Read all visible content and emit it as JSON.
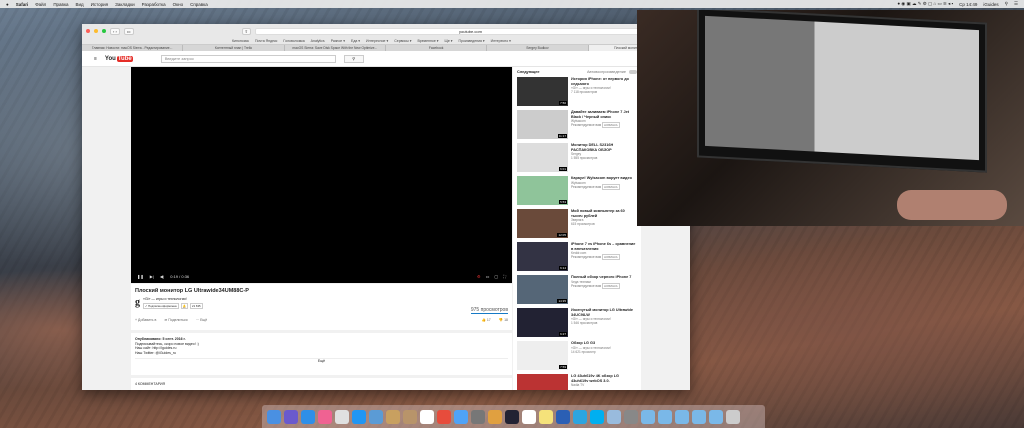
{
  "menubar": {
    "app": "Safari",
    "items": [
      "Файл",
      "Правка",
      "Вид",
      "История",
      "Закладки",
      "Разработка",
      "Окно",
      "Справка"
    ],
    "clock": "Ср 14:49",
    "user": "iGuides"
  },
  "safari": {
    "url": "youtube.com",
    "bookmarks": [
      "Кинопоиск",
      "Почта Яндекс",
      "Головоломка",
      "Analytics",
      "Разное ▾",
      "Еда ▾",
      "Интересное ▾",
      "Сервисы ▾",
      "Временное ▾",
      "Ще ▾",
      "Произведения ▾",
      "Интересно ▾"
    ],
    "tabs": [
      "Главная: Новости: macOS Sierra - Редактирование...",
      "Контентный план | Trello",
      "macOS Sierra: Save Disk Space With the New Optimize...",
      "Facebook",
      "Sergey Budkov",
      "Плоский монитор LG Ultrawide..."
    ]
  },
  "youtube": {
    "logo": "You",
    "logo_tube": "Tube",
    "search_placeholder": "Введите запрос",
    "player": {
      "time": "0:19 / 0:36"
    },
    "video": {
      "title": "Плоский монитор LG Ultrawide34UM88C-P",
      "channel": "«Gi» — игры и технологии!",
      "subscribe": "✓ Подписка оформлена",
      "subs": "21 635",
      "views": "975 просмотров",
      "add": "Добавить в",
      "share": "Поделиться",
      "more": "Ещё",
      "likes": "17",
      "dislikes": "18"
    },
    "description": {
      "published": "Опубликовано: 5 сент. 2016 г.",
      "lines": [
        "Подписывайтесь, скоро новое видео! :)",
        "Наш сайт: http://iguides.ru",
        "Наш Twitter: @iGuides_ru"
      ],
      "more": "Ещё"
    },
    "comments": "4 КОММЕНТАРИЯ",
    "sidebar": {
      "heading": "Следующее",
      "autoplay": "Автовоспроизведение",
      "items": [
        {
          "title": "История iPhone: от первого до седьмого",
          "channel": "«Gi» — игры и технологии!",
          "meta": "7 118 просмотров",
          "duration": "7:50",
          "color": "#333"
        },
        {
          "title": "Давайте заливаем iPhone 7 Jet Black / Черный оникс",
          "channel": "Wylsacom",
          "meta": "Рекомендуемое вам",
          "badge": "НОВИНКА",
          "duration": "11:17",
          "color": "#ccc"
        },
        {
          "title": "Монитор DELL S2316H РАСПАКОВКА ОБЗОР",
          "channel": "Sergey",
          "meta": "1 555 просмотров",
          "duration": "6:01",
          "color": "#ddd"
        },
        {
          "title": "Караул! Wylsacom ворует видео",
          "channel": "Wylsacom",
          "meta": "Рекомендуемое вам",
          "badge": "НОВИНКА",
          "duration": "5:53",
          "color": "#8fc49a"
        },
        {
          "title": "Мой новый компьютер за 60 тысяч рублей",
          "channel": "Зверюга",
          "meta": "615 просмотров",
          "duration": "12:05",
          "color": "#6a4a3a"
        },
        {
          "title": "iPhone 7 vs iPhone 6s – сравнение в впечатления",
          "channel": "Keddr.com",
          "meta": "Рекомендуемое вам",
          "badge": "НОВИНКА",
          "duration": "6:14",
          "color": "#334"
        },
        {
          "title": "Полный обзор черного iPhone 7",
          "channel": "Чеда техники",
          "meta": "Рекомендуемое вам",
          "badge": "НОВИНКА",
          "duration": "14:35",
          "color": "#567"
        },
        {
          "title": "Изогнутый монитор LG Ultrawide 34UC98-W",
          "channel": "«Gi» — игры и технологии!",
          "meta": "1 546 просмотров",
          "duration": "6:27",
          "color": "#223"
        },
        {
          "title": "Обзор LG G3",
          "channel": "«Gi» — игры и технологии!",
          "meta": "14 621 просмотр",
          "duration": "7:59",
          "color": "#eee"
        },
        {
          "title": "LG 43uh619v 4K обзор LG 43uh619v webOS 3.0.",
          "channel": "Nadia TV",
          "meta": "",
          "duration": "",
          "color": "#b33"
        }
      ]
    }
  },
  "dock": [
    "Finder",
    "Siri",
    "App Store",
    "iTunes",
    "Airmail",
    "Safari",
    "Tweetbot",
    "Archiver",
    "Contacts",
    "Calendar",
    "Todoist",
    "Messages",
    "System Preferences",
    "Sketch",
    "Lr",
    "iA",
    "Notes",
    "Word",
    "Telegram",
    "Skype",
    "Maps",
    "Eject",
    "Applications",
    "Documents",
    "Downloads",
    "Photos",
    "Downloads2",
    "Trash"
  ]
}
